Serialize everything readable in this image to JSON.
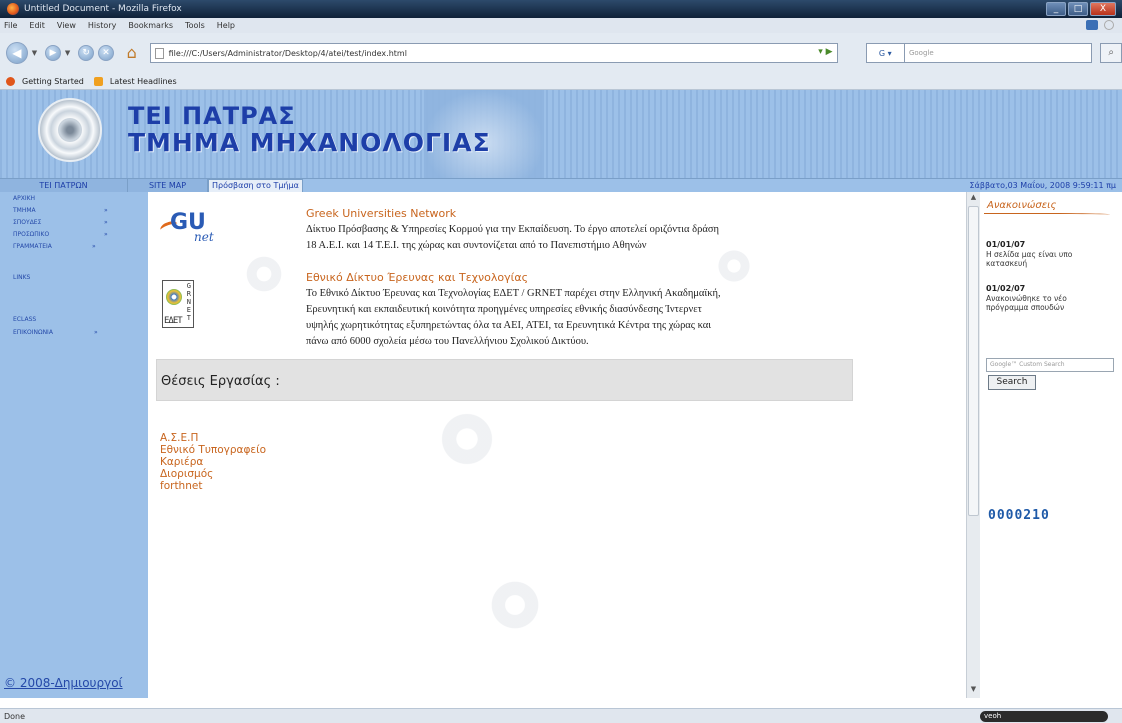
{
  "window": {
    "title": "Untitled Document - Mozilla Firefox",
    "buttons": [
      "_",
      "□",
      "X"
    ]
  },
  "menu": [
    "File",
    "Edit",
    "View",
    "History",
    "Bookmarks",
    "Tools",
    "Help"
  ],
  "toolbar": {
    "url": "file:///C:/Users/Administrator/Desktop/4/atei/test/index.html",
    "search_engine": "G",
    "search_placeholder": "Google"
  },
  "bookmarks": [
    "Getting Started",
    "Latest Headlines"
  ],
  "banner": {
    "line1": "TEI ΠΑΤΡΑΣ",
    "line2": "ΤΜΗΜΑ ΜΗΧΑΝΟΛΟΓΙΑΣ"
  },
  "topnav": {
    "items": [
      "TEI ΠΑΤΡΩΝ",
      "SITE MAP",
      "Πρόσβαση στο Τμήμα"
    ],
    "datetime": "Σάββατο,03 Μαΐου, 2008 9:59:11 πμ"
  },
  "leftnav": {
    "items": [
      {
        "label": "ΑΡΧΙΚΗ",
        "arrow": ""
      },
      {
        "label": "ΤΜΗΜΑ",
        "arrow": "»"
      },
      {
        "label": "ΣΠΟΥΔΕΣ",
        "arrow": "»"
      },
      {
        "label": "ΠΡΟΣΩΠΙΚΟ",
        "arrow": "»"
      },
      {
        "label": "ΓΡΑΜΜΑΤΕΙΑ",
        "arrow": "»"
      },
      {
        "label": "LINKS",
        "arrow": ""
      },
      {
        "label": "ECLASS",
        "arrow": ""
      },
      {
        "label": "ΕΠΙΚΟΙΝΩΝΙΑ",
        "arrow": "»"
      }
    ],
    "copyright": "© 2008-Δημιουργοί"
  },
  "entries": [
    {
      "title": "Greek Universities Network",
      "lines": [
        "Δίκτυο Πρόσβασης & Υπηρεσίες Κορμού για την Εκπαίδευση. Το έργο αποτελεί οριζόντια δράση",
        "18 Α.Ε.Ι. και 14 Τ.Ε.Ι. της χώρας και συντονίζεται από το Πανεπιστήμιο Αθηνών"
      ]
    },
    {
      "title": "Εθνικό Δίκτυο Έρευνας και Τεχνολογίας",
      "lines": [
        "Το Εθνικό Δίκτυο Έρευνας και Τεχνολογίας ΕΔΕΤ / GRNET παρέχει στην Ελληνική Ακαδημαϊκή,",
        "Ερευνητική και εκπαιδευτική κοινότητα προηγμένες υπηρεσίες εθνικής διασύνδεσης Ίντερνετ",
        "υψηλής χωρητικότητας εξυπηρετώντας όλα τα ΑΕΙ, ΑΤΕΙ, τα Ερευνητικά Κέντρα της χώρας και",
        "πάνω από 6000 σχολεία μέσω του Πανελλήνιου Σχολικού Δικτύου."
      ]
    }
  ],
  "logos": {
    "gun": {
      "letters": "GU",
      "sub": "net"
    },
    "grnet": {
      "letters": "GRNET",
      "sub": "ΕΔΕΤ"
    }
  },
  "jobs": {
    "label": "Θέσεις Εργασίας :",
    "links": [
      "Α.Σ.Ε.Π",
      "Εθνικό Τυπογραφείο",
      "Καριέρα",
      "Διορισμός",
      "forthnet"
    ]
  },
  "sidebar": {
    "title": "Ανακοινώσεις",
    "news": [
      {
        "date": "01/01/07",
        "text": "Η σελίδα μας είναι υπο κατασκευή"
      },
      {
        "date": "01/02/07",
        "text": "Ανακοινώθηκε το νέο πρόγραμμα σπουδών"
      }
    ],
    "search_placeholder": "Google™ Custom Search",
    "search_button": "Search",
    "counter": "0000210"
  },
  "status": {
    "text": "Done",
    "addon": "veoh"
  },
  "colors": {
    "sidebar_bg": "#9cc0e8",
    "link_orange": "#c8651e",
    "nav_blue": "#2448a8"
  }
}
